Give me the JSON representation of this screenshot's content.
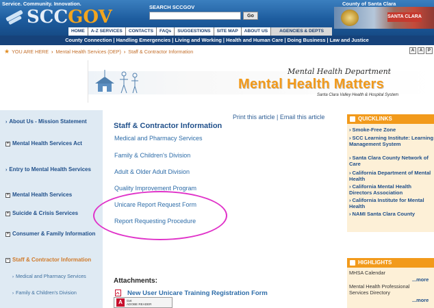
{
  "header": {
    "tagline": "Service. Community. Innovation.",
    "logo_part1": "SCC",
    "logo_part2": "GOV",
    "search_label": "SEARCH SCCGOV",
    "search_placeholder": "",
    "go_label": "Go",
    "county_label": "County of Santa Clara",
    "photo_sign": "SANTA CLARA",
    "top_nav": [
      "HOME",
      "A-Z SERVICES",
      "CONTACTS",
      "FAQs",
      "SUGGESTIONS",
      "SITE MAP",
      "ABOUT US",
      "AGENCIES & DEPTS"
    ]
  },
  "blue_nav": [
    "County Connection",
    "Handling Emergencies",
    "Living and Working",
    "Health and Human Care",
    "Doing Business",
    "Law and Justice"
  ],
  "breadcrumb": {
    "prefix": "YOU ARE HERE",
    "items": [
      "Mental Health Services (DEP)",
      "Staff & Contractor Information"
    ]
  },
  "tools": [
    "A",
    "A",
    "P"
  ],
  "banner": {
    "department": "Mental Health Department",
    "title": "Mental Health Matters",
    "system": "Santa Clara Valley Health & Hospital System"
  },
  "left_nav": {
    "items": [
      {
        "type": "bullet",
        "label": "About Us - Mission Statement"
      },
      {
        "type": "plus",
        "label": "Mental Health Services Act"
      },
      {
        "type": "bullet",
        "label": "Entry to Mental Health Services"
      },
      {
        "type": "plus",
        "label": "Mental Health Services"
      },
      {
        "type": "plus",
        "label": "Suicide & Crisis Services"
      },
      {
        "type": "plus",
        "label": "Consumer & Family Information"
      },
      {
        "type": "minus",
        "label": "Staff & Contractor Information"
      }
    ],
    "sub_items": [
      "Medical and Pharmacy Services",
      "Family & Children's Division"
    ]
  },
  "main": {
    "print_article": "Print this article",
    "email_article": "Email this article",
    "title": "Staff & Contractor Information",
    "links": [
      "Medical and Pharmacy Services",
      "Family & Children's Division",
      "Adult & Older Adult Division",
      "Quality Improvement Program",
      "Unicare Report Request Form",
      "Report Requesting Procedure"
    ],
    "attachments_title": "Attachments:",
    "attachment_link": "New User Unicare Training Registration Form",
    "adobe_line1": "Get",
    "adobe_line2": "ADOBE READER"
  },
  "quicklinks": {
    "title": "QUICKLINKS",
    "items": [
      "Smoke-Free Zone",
      "SCC Learning Institute: Learning Management System",
      "Santa Clara County Network of Care",
      "California Department of Mental Health",
      "California Mental Health Directors Association",
      "California Institute for Mental Health",
      "NAMI Santa Clara County"
    ]
  },
  "highlights": {
    "title": "HIGHLIGHTS",
    "items": [
      "MHSA Calendar",
      "Mental Health Professional Services Directory"
    ],
    "more": "...more"
  },
  "colors": {
    "header_blue": "#1d5c9e",
    "nav_blue": "#16427a",
    "accent_orange": "#f29a1b",
    "link_blue": "#2d6ca8",
    "highlight_circle": "#e033c9"
  }
}
